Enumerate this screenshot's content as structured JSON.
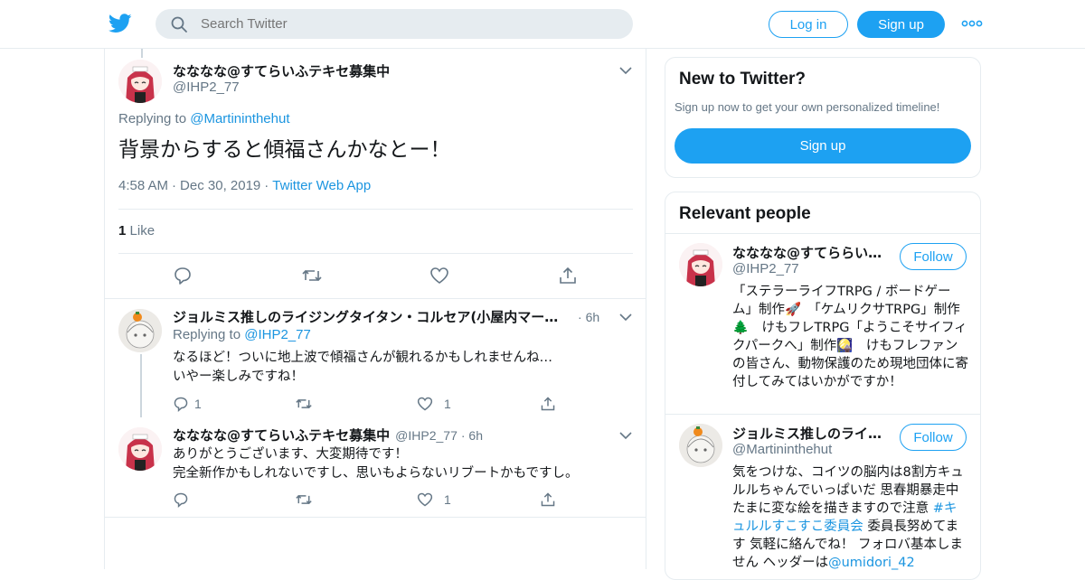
{
  "header": {
    "search_placeholder": "Search Twitter",
    "login_label": "Log in",
    "signup_label": "Sign up",
    "brand_color": "#1da1f2"
  },
  "focused_tweet": {
    "name": "なななな@すてらいふテキセ募集中",
    "handle": "@IHP2_77",
    "replying_prefix": "Replying to",
    "replying_to": "@Martininthehut",
    "text": "背景からすると傾福さんかなとー！",
    "time": "4:58 AM",
    "date": "Dec 30, 2019",
    "source": "Twitter Web App",
    "like_count": "1",
    "like_label": "Like"
  },
  "replies": [
    {
      "name": "ジョルミス推しのライジングタイタン・コルセア(小屋内マーテ…",
      "handle": "",
      "time": "6h",
      "replying_prefix": "Replying to",
      "replying_to": "@IHP2_77",
      "line1": "なるほど！ついに地上波で傾福さんが観れるかもしれませんね…",
      "line2": "いやー楽しみですね！",
      "reply_count": "1",
      "retweet_count": "",
      "like_count": "1"
    },
    {
      "name": "なななな@すてらいふテキセ募集中",
      "handle": "@IHP2_77",
      "time": "6h",
      "line1": "ありがとうございます、大変期待です！",
      "line2": "完全新作かもしれないですし、思いもよらないリブートかもですし。",
      "reply_count": "",
      "retweet_count": "",
      "like_count": "1"
    }
  ],
  "sidebar": {
    "new_title": "New to Twitter?",
    "new_sub": "Sign up now to get your own personalized timeline!",
    "signup_label": "Sign up",
    "relevant_title": "Relevant people",
    "people": [
      {
        "name": "なななな@すてららいふ…",
        "handle": "@IHP2_77",
        "follow_label": "Follow",
        "bio": "「ステラーライフTRPG / ボードゲーム」制作🚀　「ケムリクサTRPG」制作🌲　けもフレTRPG「ようこそサイフィクパークへ」制作🎑　けもフレファンの皆さん、動物保護のため現地団体に寄付してみてはいかがですか！"
      },
      {
        "name": "ジョルミス推しのライ…",
        "handle": "@Martininthehut",
        "follow_label": "Follow",
        "bio_1": "気をつけな、コイツの脳内は8割方キュルルちゃんでいっぱいだ 思春期暴走中 たまに変な絵を描きますので注意 ",
        "bio_tag": "#キュルルすこすこ委員会",
        "bio_2": " 委員長努めてます 気軽に絡んでね！ フォロバ基本しません ヘッダーは",
        "bio_link": "@umidori_42"
      }
    ]
  }
}
